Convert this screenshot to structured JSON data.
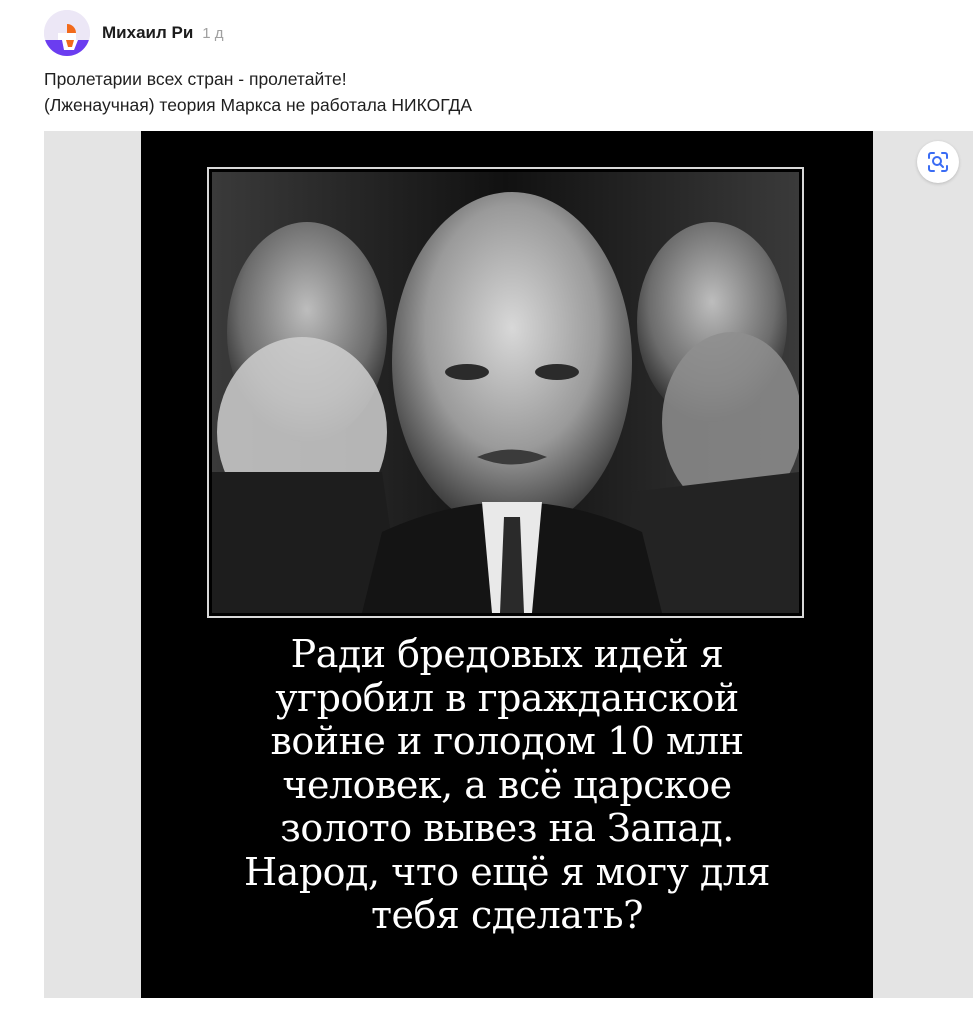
{
  "comment": {
    "author": "Михаил Ри",
    "time": "1 д",
    "text_lines": [
      "Пролетарии всех стран - пролетайте!",
      "(Лженаучная) теория Маркса не работала НИКОГДА"
    ]
  },
  "image": {
    "caption_lines": [
      "Ради бредовых идей я",
      "угробил в гражданской",
      "войне и голодом 10 млн",
      "человек, а всё царское",
      "золото вывез на Запад.",
      "Народ, что ещё я могу для",
      "тебя сделать?"
    ],
    "lens_icon": "image-search-lens-icon"
  },
  "colors": {
    "avatar_purple": "#6b3df0",
    "avatar_orange": "#f26a1b",
    "poster_bg": "#000000",
    "page_bg": "#ffffff",
    "media_bg": "#e4e4e4",
    "lens_icon": "#3a6cf4"
  }
}
